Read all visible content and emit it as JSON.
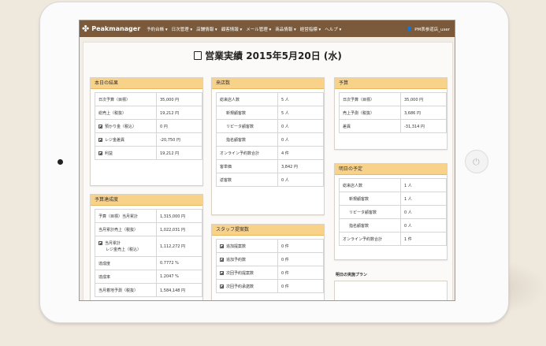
{
  "app": {
    "name": "Peakmanager"
  },
  "menu": [
    "予約台帳 ▾",
    "日次管理 ▾",
    "店舗情報 ▾",
    "顧客情報 ▾",
    "メール管理 ▾",
    "商品情報 ▾",
    "経営指標 ▾",
    "ヘルプ ▾"
  ],
  "user": "PM表参道店_user",
  "page_title": "営業実績 2015年5月20日 (水)",
  "today": {
    "header": "本日の結果",
    "rows": [
      {
        "label": "日次予算（目標）",
        "value": "35,000 円",
        "check": false
      },
      {
        "label": "総売上（税抜）",
        "value": "19,212 円",
        "check": false
      },
      {
        "label": "預かり金（税込）",
        "value": "0 円",
        "check": true
      },
      {
        "label": "レジ金差異",
        "value": "-20,750 円",
        "check": true
      },
      {
        "label": "利益",
        "value": "19,212 円",
        "check": true
      }
    ]
  },
  "visits": {
    "header": "来店数",
    "rows": [
      {
        "label": "総来店人数",
        "value": "5 人",
        "indent": false
      },
      {
        "label": "新規顧客数",
        "value": "5 人",
        "indent": true
      },
      {
        "label": "リピータ顧客数",
        "value": "0 人",
        "indent": true
      },
      {
        "label": "指名顧客数",
        "value": "0 人",
        "indent": true
      },
      {
        "label": "オンライン予約数合計",
        "value": "4 件",
        "indent": false
      },
      {
        "label": "客単価",
        "value": "3,842 円",
        "indent": false
      },
      {
        "label": "返客数",
        "value": "0 人",
        "indent": false
      }
    ]
  },
  "forecast": {
    "header": "予算",
    "rows": [
      {
        "label": "日次予算（目標）",
        "value": "35,000 円"
      },
      {
        "label": "売上予測（税抜）",
        "value": "3,686 円"
      },
      {
        "label": "差異",
        "value": "-31,314 円"
      }
    ]
  },
  "tomorrow": {
    "header": "明日の予定",
    "rows": [
      {
        "label": "総来店人数",
        "value": "1 人",
        "indent": false
      },
      {
        "label": "新規顧客数",
        "value": "1 人",
        "indent": true
      },
      {
        "label": "リピータ顧客数",
        "value": "0 人",
        "indent": true
      },
      {
        "label": "指名顧客数",
        "value": "0 人",
        "indent": true
      },
      {
        "label": "オンライン予約数合計",
        "value": "1 件",
        "indent": false
      }
    ],
    "plan_label": "明日の実施プラン"
  },
  "budget": {
    "header": "予算達成度",
    "rows": [
      {
        "label": "予算（目標）当月累計",
        "value": "1,315,000 円",
        "check": false,
        "label2": ""
      },
      {
        "label": "当月累計売上（税抜）",
        "value": "1,022,031 円",
        "check": false,
        "label2": ""
      },
      {
        "label": "当月累計",
        "value": "1,112,272 円",
        "check": true,
        "label2": "レジ金売上（税込）"
      },
      {
        "label": "達成度",
        "value": "0.7772 %",
        "check": false,
        "label2": ""
      },
      {
        "label": "達成率",
        "value": "1.2047 %",
        "check": false,
        "label2": ""
      },
      {
        "label": "当月着地予測（税抜）",
        "value": "1,584,148 円",
        "check": false,
        "label2": ""
      }
    ]
  },
  "staff": {
    "header": "スタッフ提案数",
    "rows": [
      {
        "label": "追加提案数",
        "value": "0 件"
      },
      {
        "label": "追加予約数",
        "value": "0 件"
      },
      {
        "label": "次回予約提案数",
        "value": "0 件"
      },
      {
        "label": "次回予約承諾数",
        "value": "0 件"
      }
    ]
  }
}
